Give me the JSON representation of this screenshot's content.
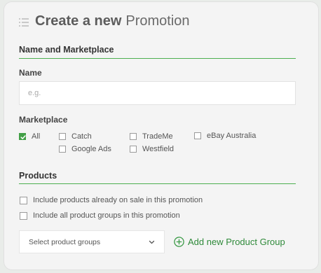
{
  "page": {
    "title_strong": "Create a new",
    "title_light": "Promotion"
  },
  "name_marketplace": {
    "heading": "Name and Marketplace",
    "name_label": "Name",
    "name_placeholder": "e.g.",
    "name_value": "",
    "marketplace_label": "Marketplace",
    "marketplaces": [
      {
        "label": "All",
        "checked": true
      },
      {
        "label": "Catch",
        "checked": false
      },
      {
        "label": "TradeMe",
        "checked": false
      },
      {
        "label": "eBay Australia",
        "checked": false
      },
      {
        "label": "Google Ads",
        "checked": false
      },
      {
        "label": "Westfield",
        "checked": false
      }
    ]
  },
  "products": {
    "heading": "Products",
    "options": [
      {
        "label": "Include products already on sale in this promotion",
        "checked": false
      },
      {
        "label": "Include all product groups in this promotion",
        "checked": false
      }
    ],
    "select_placeholder": "Select product groups",
    "add_group_label": "Add new Product Group"
  },
  "colors": {
    "accent": "#43a047",
    "link": "#2f8a3a"
  },
  "icons": {
    "title": "list-menu-icon",
    "select": "chevron-down-icon",
    "add": "plus-circle-icon",
    "check": "check-icon"
  }
}
